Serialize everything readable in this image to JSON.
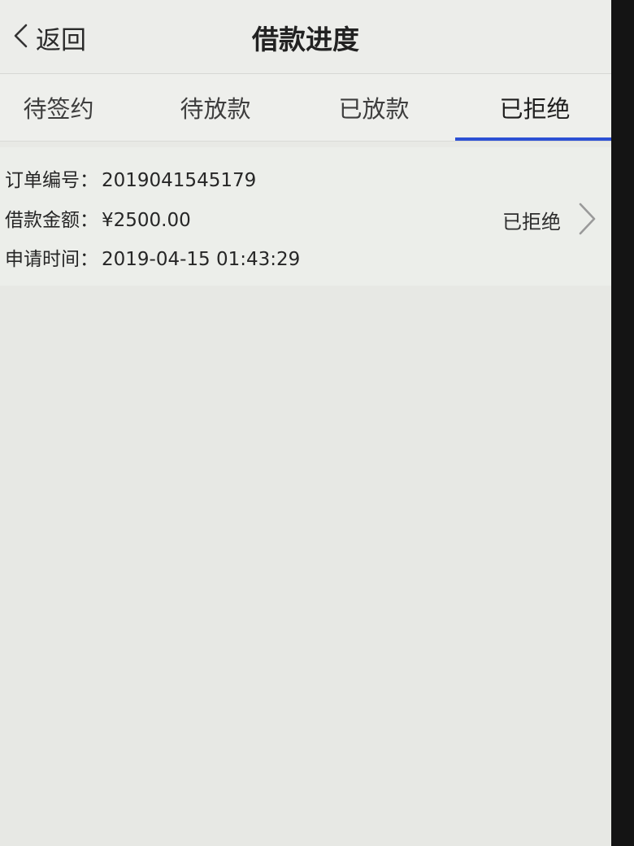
{
  "header": {
    "back_label": "返回",
    "title": "借款进度"
  },
  "tabs": [
    {
      "label": "待签约",
      "active": false
    },
    {
      "label": "待放款",
      "active": false
    },
    {
      "label": "已放款",
      "active": false
    },
    {
      "label": "已拒绝",
      "active": true
    }
  ],
  "order": {
    "number_label": "订单编号：",
    "number": "2019041545179",
    "amount_label": "借款金额：",
    "amount": "¥2500.00",
    "time_label": "申请时间：",
    "time": "2019-04-15 01:43:29",
    "status": "已拒绝"
  },
  "colors": {
    "accent": "#2c50d4",
    "background": "#e8e9e5"
  },
  "icons": {
    "back": "chevron-left-icon",
    "row_action": "chevron-right-icon"
  }
}
